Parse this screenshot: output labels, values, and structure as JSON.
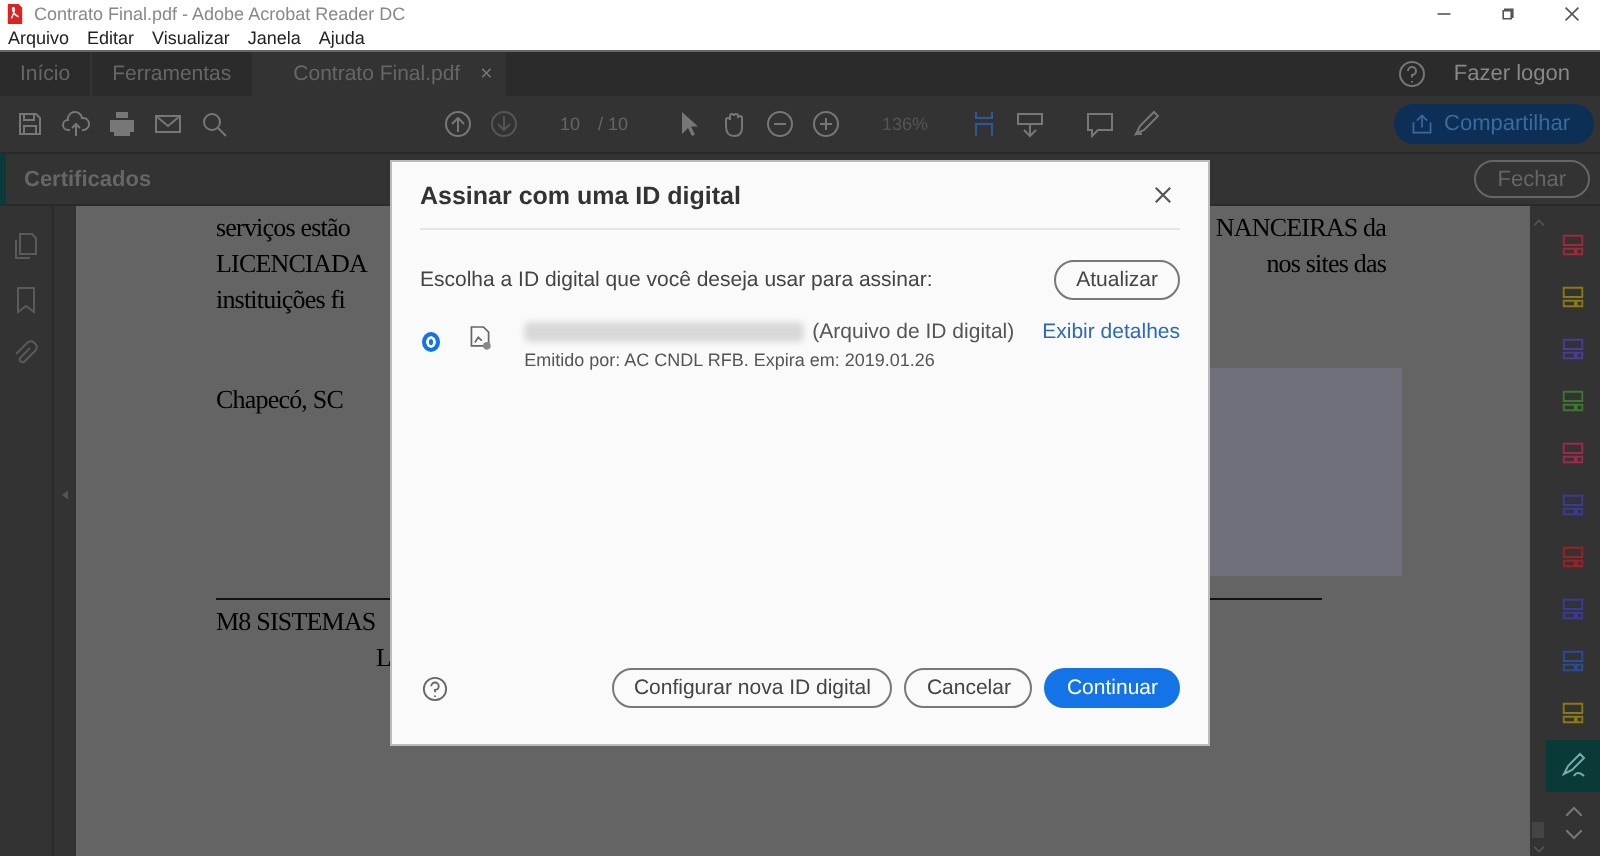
{
  "window": {
    "title": "Contrato Final.pdf - Adobe Acrobat Reader DC"
  },
  "menu": [
    "Arquivo",
    "Editar",
    "Visualizar",
    "Janela",
    "Ajuda"
  ],
  "tabs": [
    {
      "label": "Início",
      "selected": false
    },
    {
      "label": "Ferramentas",
      "selected": false
    },
    {
      "label": "Contrato Final.pdf",
      "selected": true,
      "close": "×"
    }
  ],
  "account": {
    "label": "Fazer logon"
  },
  "toolbar": {
    "page_current": "10",
    "page_total": "/ 10",
    "zoom": "136%",
    "share_button": "Compartilhar"
  },
  "panel": {
    "title": "Certificados",
    "close_button": "Fechar"
  },
  "document": {
    "lines": [
      {
        "left": "serviços estão",
        "right": "NANCEIRAS da"
      },
      {
        "left": "LICENCIADA",
        "right": "nos sites das"
      },
      {
        "left": "instituições fi"
      }
    ],
    "place_date": "Chapecó, SC",
    "signature_lines": [
      "M8 SISTEMAS",
      "L"
    ]
  },
  "dialog": {
    "title": "Assinar com uma ID digital",
    "prompt": "Escolha a ID digital que você deseja usar para assinar:",
    "refresh_button": "Atualizar",
    "ids": [
      {
        "selected": true,
        "type": "(Arquivo de ID digital)",
        "details_link": "Exibir detalhes",
        "issuer": "Emitido por: AC CNDL RFB. Expira em: 2019.01.26"
      }
    ],
    "buttons": [
      {
        "label": "Configurar nova ID digital",
        "kind": "secondary"
      },
      {
        "label": "Cancelar",
        "kind": "secondary"
      },
      {
        "label": "Continuar",
        "kind": "primary"
      }
    ]
  }
}
